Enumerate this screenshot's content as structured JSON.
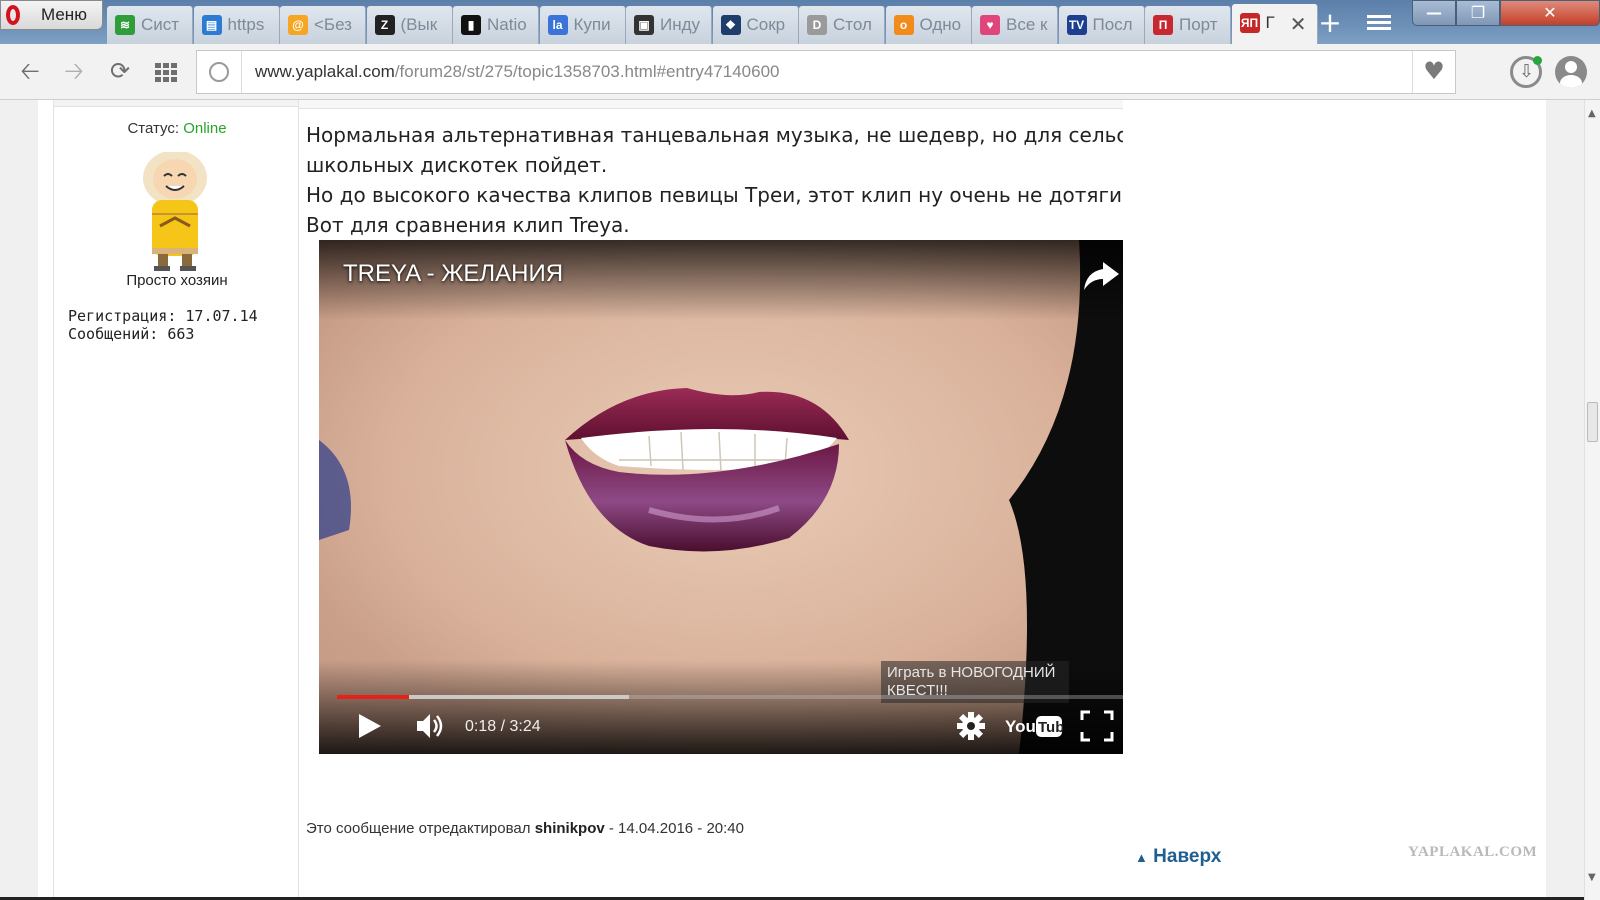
{
  "browser": {
    "menu_label": "Меню",
    "tabs": [
      {
        "title": "Сист",
        "icon": "feed-icon",
        "color": "#2f9d3a"
      },
      {
        "title": "https",
        "icon": "page-icon",
        "color": "#2a7bd1"
      },
      {
        "title": "<Без",
        "icon": "mail-at-icon",
        "color": "#f5a623"
      },
      {
        "title": "(Вык",
        "icon": "zen-icon",
        "color": "#222222"
      },
      {
        "title": "Natio",
        "icon": "film-icon",
        "color": "#111111"
      },
      {
        "title": "Купи",
        "icon": "la-icon",
        "color": "#3a74d9"
      },
      {
        "title": "Инду",
        "icon": "film-strip-icon",
        "color": "#333333"
      },
      {
        "title": "Сокр",
        "icon": "reel-icon",
        "color": "#1f3d6b"
      },
      {
        "title": "Стол",
        "icon": "d-icon",
        "color": "#9a9a9a"
      },
      {
        "title": "Одно",
        "icon": "ok-icon",
        "color": "#f38b1b"
      },
      {
        "title": "Все к",
        "icon": "heart-icon",
        "color": "#e0457b"
      },
      {
        "title": "Посл",
        "icon": "tv-icon",
        "color": "#1d3f8f"
      },
      {
        "title": "Порт",
        "icon": "p-icon",
        "color": "#c8282f"
      },
      {
        "title": "Г",
        "icon": "yaplakal-icon",
        "color": "#c62828",
        "active": true
      }
    ]
  },
  "address_bar": {
    "url_host": "www.yaplakal.com",
    "url_path": "/forum28/st/275/topic1358703.html#entry47140600"
  },
  "user": {
    "status_label": "Статус:",
    "status_value": "Online",
    "rank": "Просто хозяин",
    "registration_label": "Регистрация:",
    "registration_date": "17.07.14",
    "messages_label": "Сообщений:",
    "messages_count": "663"
  },
  "post": {
    "lines": [
      "Нормальная альтернативная танцевальная музыка, не шедевр, но для сельских и",
      "школьных дискотек пойдет.",
      "Но до высокого качества клипов певицы Треи, этот клип ну очень не дотягивает.",
      "Вот для сравнения клип Treya."
    ],
    "edited_prefix": "Это сообщение отредактировал",
    "edited_user": "shinikpov",
    "edited_time": "- 14.04.2016 - 20:40"
  },
  "video": {
    "title": "TREYA - ЖЕЛАНИЯ",
    "promo_line1": "Играть в НОВОГОДНИЙ",
    "promo_line2": "КВЕСТ!!!",
    "time": "0:18 / 3:24",
    "played_fraction": 0.0915,
    "buffered_fraction": 0.371,
    "logo": "YouTube"
  },
  "page": {
    "to_top": "Наверх",
    "watermark": "YAPLAKAL.COM"
  },
  "colors": {
    "online": "#29a327",
    "link": "#1f5f8f",
    "progress_played": "#e62117"
  }
}
